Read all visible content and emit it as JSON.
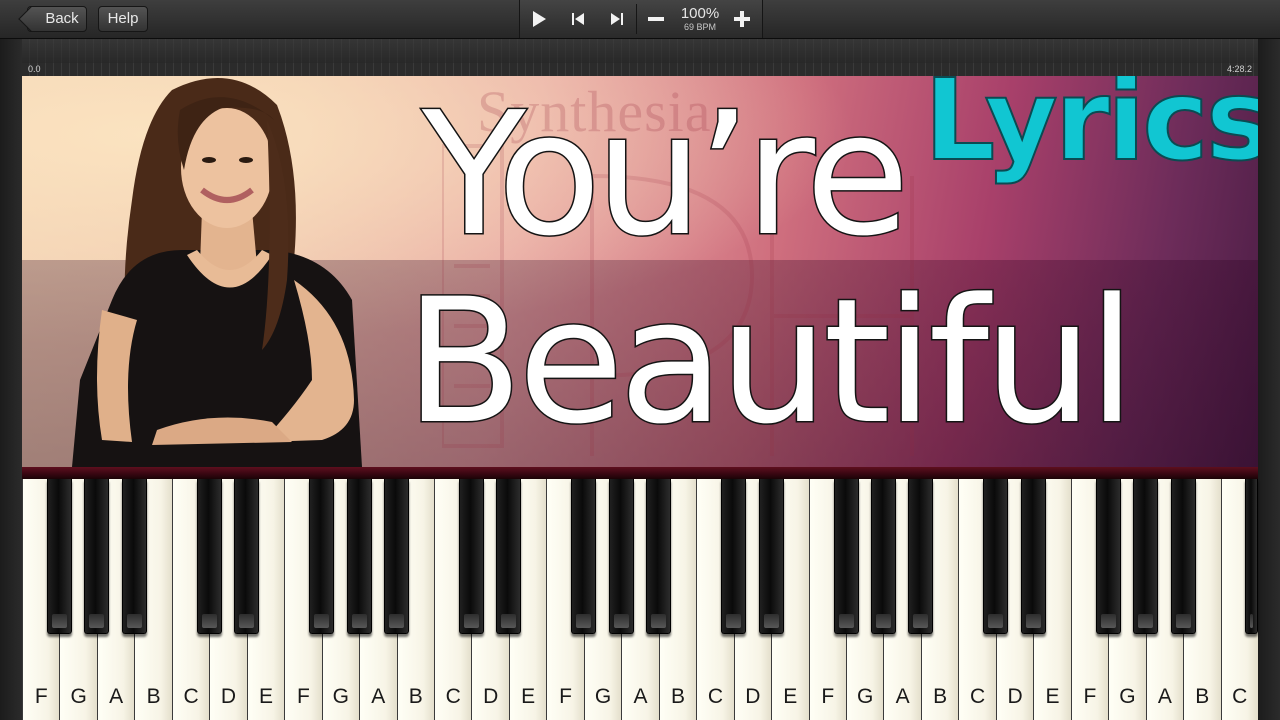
{
  "toolbar": {
    "back_label": "Back",
    "help_label": "Help",
    "speed": "100%",
    "bpm": "69 BPM"
  },
  "timeline": {
    "start_time": "0.0",
    "end_time": "4:28.2"
  },
  "banner": {
    "title_line1": "You’re",
    "title_line2": "Beautiful",
    "tag": "Lyrics",
    "watermark": "Synthesia",
    "colors": {
      "tag": "#11c6d2",
      "title": "#ffffff"
    }
  },
  "keyboard": {
    "white_keys": [
      "F",
      "G",
      "A",
      "B",
      "C",
      "D",
      "E",
      "F",
      "G",
      "A",
      "B",
      "C",
      "D",
      "E",
      "F",
      "G",
      "A",
      "B",
      "C",
      "D",
      "E",
      "F",
      "G",
      "A",
      "B",
      "C",
      "D",
      "E",
      "F",
      "G",
      "A",
      "B",
      "C"
    ]
  }
}
